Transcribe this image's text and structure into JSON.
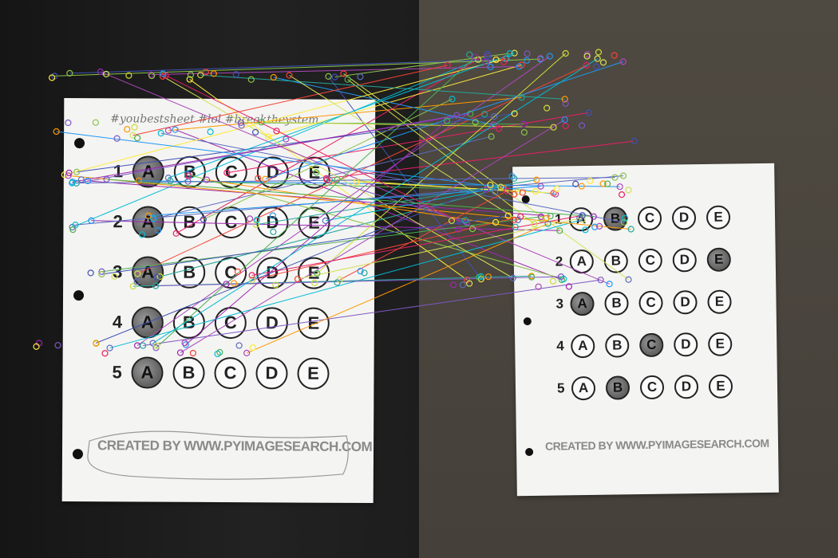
{
  "image": {
    "left_sheet": {
      "scribble": "#youbestsheet #lol #breaktheystem",
      "questions": [
        {
          "number": "1",
          "options": [
            "A",
            "B",
            "C",
            "D",
            "E"
          ],
          "filled": "A"
        },
        {
          "number": "2",
          "options": [
            "A",
            "B",
            "C",
            "D",
            "E"
          ],
          "filled": "A"
        },
        {
          "number": "3",
          "options": [
            "A",
            "B",
            "C",
            "D",
            "E"
          ],
          "filled": "A"
        },
        {
          "number": "4",
          "options": [
            "A",
            "B",
            "C",
            "D",
            "E"
          ],
          "filled": "A"
        },
        {
          "number": "5",
          "options": [
            "A",
            "B",
            "C",
            "D",
            "E"
          ],
          "filled": "A"
        }
      ],
      "credit": "CREATED BY WWW.PYIMAGESEARCH.COM"
    },
    "right_sheet": {
      "questions": [
        {
          "number": "1",
          "options": [
            "A",
            "B",
            "C",
            "D",
            "E"
          ],
          "filled": "B"
        },
        {
          "number": "2",
          "options": [
            "A",
            "B",
            "C",
            "D",
            "E"
          ],
          "filled": "E"
        },
        {
          "number": "3",
          "options": [
            "A",
            "B",
            "C",
            "D",
            "E"
          ],
          "filled": "A"
        },
        {
          "number": "4",
          "options": [
            "A",
            "B",
            "C",
            "D",
            "E"
          ],
          "filled": "C"
        },
        {
          "number": "5",
          "options": [
            "A",
            "B",
            "C",
            "D",
            "E"
          ],
          "filled": "B"
        }
      ],
      "credit": "CREATED BY WWW.PYIMAGESEARCH.COM"
    },
    "match_colors": [
      "#e91e63",
      "#9c27b0",
      "#3f51b5",
      "#2196f3",
      "#00bcd4",
      "#4caf50",
      "#8bc34a",
      "#cddc39",
      "#ffeb3b",
      "#ff9800",
      "#f44336",
      "#ab47bc",
      "#5c6bc0",
      "#26a69a",
      "#d4e157",
      "#7e57c2"
    ]
  }
}
